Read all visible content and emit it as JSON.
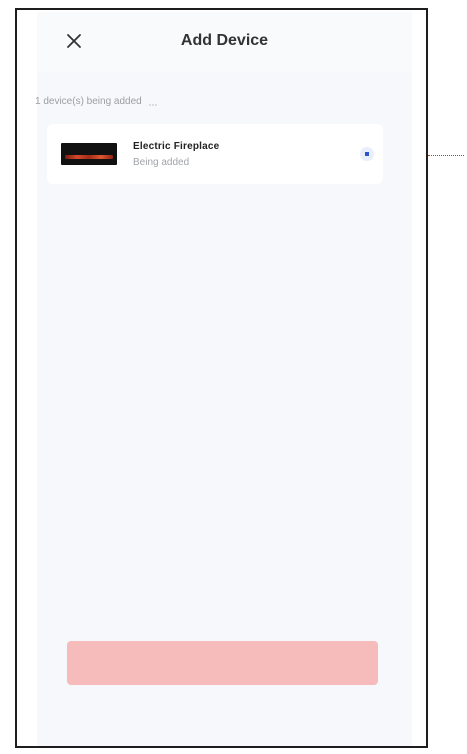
{
  "header": {
    "title": "Add Device",
    "close_icon": "close-icon"
  },
  "status": {
    "text": "1 device(s) being added",
    "icon": "loading-spinner-icon"
  },
  "device": {
    "name": "Electric Fireplace",
    "status": "Being added",
    "thumbnail": "fireplace-thumbnail",
    "progress_icon": "progress-indicator-icon"
  },
  "footer": {
    "button_label": ""
  },
  "colors": {
    "accent": "#2f54c7",
    "button_disabled": "#f6bcbc",
    "leader_line": "#c0392b"
  }
}
